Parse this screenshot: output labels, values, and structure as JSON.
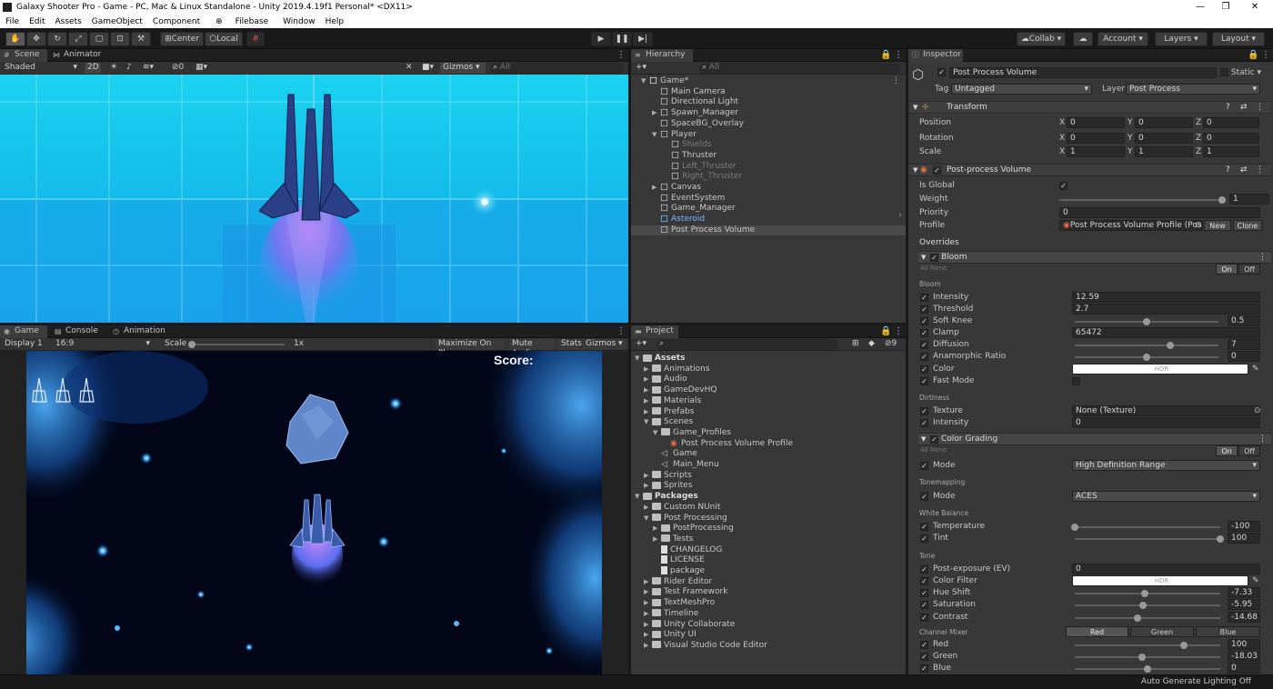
{
  "window": {
    "title": "Galaxy Shooter Pro - Game - PC, Mac & Linux Standalone - Unity 2019.4.19f1 Personal* <DX11>"
  },
  "menu": [
    "File",
    "Edit",
    "Assets",
    "GameObject",
    "Component",
    "Filebase",
    "Window",
    "Help"
  ],
  "toolbar": {
    "center": "Center",
    "local": "Local",
    "collab": "Collab",
    "account": "Account",
    "layers": "Layers",
    "layout": "Layout"
  },
  "scene": {
    "tabs": [
      "Scene",
      "Animator"
    ],
    "shading": "Shaded",
    "mode2d": "2D",
    "fx_count": "0",
    "gizmos": "Gizmos",
    "search_placeholder": "All"
  },
  "game": {
    "tabs": [
      "Game",
      "Console",
      "Animation"
    ],
    "display": "Display 1",
    "aspect": "16:9",
    "scale_label": "Scale",
    "scale_value": "1x",
    "maximize": "Maximize On Play",
    "mute": "Mute Audio",
    "stats": "Stats",
    "gizmos": "Gizmos",
    "score_label": "Score:"
  },
  "hierarchy": {
    "tab": "Hierarchy",
    "search_placeholder": "All",
    "items": [
      {
        "label": "Game*",
        "depth": 0,
        "expanded": true,
        "dim": false
      },
      {
        "label": "Main Camera",
        "depth": 1,
        "dim": false
      },
      {
        "label": "Directional Light",
        "depth": 1,
        "dim": false
      },
      {
        "label": "Spawn_Manager",
        "depth": 1,
        "collapsed": true,
        "dim": false
      },
      {
        "label": "SpaceBG_Overlay",
        "depth": 1,
        "dim": false
      },
      {
        "label": "Player",
        "depth": 1,
        "expanded": true,
        "dim": false
      },
      {
        "label": "Shields",
        "depth": 2,
        "dim": true
      },
      {
        "label": "Thruster",
        "depth": 2,
        "dim": false
      },
      {
        "label": "Left_Thruster",
        "depth": 2,
        "dim": true
      },
      {
        "label": "Right_Thruster",
        "depth": 2,
        "dim": true
      },
      {
        "label": "Canvas",
        "depth": 1,
        "collapsed": true,
        "dim": false
      },
      {
        "label": "EventSystem",
        "depth": 1,
        "dim": false
      },
      {
        "label": "Game_Manager",
        "depth": 1,
        "dim": false
      },
      {
        "label": "Asteroid",
        "depth": 1,
        "prefab": true,
        "dim": false
      },
      {
        "label": "Post Process Volume",
        "depth": 1,
        "selected": true,
        "dim": false
      }
    ]
  },
  "project": {
    "tab": "Project",
    "count": "9",
    "items": [
      {
        "label": "Assets",
        "depth": 0,
        "bold": true,
        "kind": "folder"
      },
      {
        "label": "Animations",
        "depth": 1,
        "kind": "folder"
      },
      {
        "label": "Audio",
        "depth": 1,
        "kind": "folder"
      },
      {
        "label": "GameDevHQ",
        "depth": 1,
        "kind": "folder"
      },
      {
        "label": "Materials",
        "depth": 1,
        "kind": "folder"
      },
      {
        "label": "Prefabs",
        "depth": 1,
        "kind": "folder"
      },
      {
        "label": "Scenes",
        "depth": 1,
        "kind": "folder"
      },
      {
        "label": "Game_Profiles",
        "depth": 2,
        "kind": "folder"
      },
      {
        "label": "Post Process Volume Profile",
        "depth": 3,
        "kind": "profile"
      },
      {
        "label": "Game",
        "depth": 2,
        "kind": "scene"
      },
      {
        "label": "Main_Menu",
        "depth": 2,
        "kind": "scene"
      },
      {
        "label": "Scripts",
        "depth": 1,
        "kind": "folder"
      },
      {
        "label": "Sprites",
        "depth": 1,
        "kind": "folder"
      },
      {
        "label": "Packages",
        "depth": 0,
        "bold": true,
        "kind": "folder"
      },
      {
        "label": "Custom NUnit",
        "depth": 1,
        "kind": "folder"
      },
      {
        "label": "Post Processing",
        "depth": 1,
        "kind": "folder"
      },
      {
        "label": "PostProcessing",
        "depth": 2,
        "kind": "folder"
      },
      {
        "label": "Tests",
        "depth": 2,
        "kind": "folder"
      },
      {
        "label": "CHANGELOG",
        "depth": 2,
        "kind": "doc"
      },
      {
        "label": "LICENSE",
        "depth": 2,
        "kind": "doc"
      },
      {
        "label": "package",
        "depth": 2,
        "kind": "doc"
      },
      {
        "label": "Rider Editor",
        "depth": 1,
        "kind": "folder"
      },
      {
        "label": "Test Framework",
        "depth": 1,
        "kind": "folder"
      },
      {
        "label": "TextMeshPro",
        "depth": 1,
        "kind": "folder"
      },
      {
        "label": "Timeline",
        "depth": 1,
        "kind": "folder"
      },
      {
        "label": "Unity Collaborate",
        "depth": 1,
        "kind": "folder"
      },
      {
        "label": "Unity UI",
        "depth": 1,
        "kind": "folder"
      },
      {
        "label": "Visual Studio Code Editor",
        "depth": 1,
        "kind": "folder"
      }
    ]
  },
  "inspector": {
    "tab": "Inspector",
    "object_name": "Post Process Volume",
    "static": "Static",
    "tag_label": "Tag",
    "tag_value": "Untagged",
    "layer_label": "Layer",
    "layer_value": "Post Process",
    "transform": {
      "title": "Transform",
      "position": "Position",
      "rotation": "Rotation",
      "scale": "Scale",
      "x": "X",
      "y": "Y",
      "z": "Z",
      "pos": [
        "0",
        "0",
        "0"
      ],
      "rot": [
        "0",
        "0",
        "0"
      ],
      "scl": [
        "1",
        "1",
        "1"
      ]
    },
    "ppv": {
      "title": "Post-process Volume",
      "is_global": "Is Global",
      "weight": "Weight",
      "weight_value": "1",
      "priority": "Priority",
      "priority_value": "0",
      "profile": "Profile",
      "profile_value": "Post Process Volume Profile (Pos",
      "new": "New",
      "clone": "Clone",
      "overrides": "Overrides"
    },
    "bloom": {
      "title": "Bloom",
      "all": "All",
      "none": "None",
      "on": "On",
      "off": "Off",
      "group": "Bloom",
      "dirtiness": "Dirtiness",
      "rows": [
        {
          "label": "Intensity",
          "value": "12.59",
          "type": "field"
        },
        {
          "label": "Threshold",
          "value": "2.7",
          "type": "field"
        },
        {
          "label": "Soft Knee",
          "value": "0.5",
          "type": "slider",
          "fill": 0.5
        },
        {
          "label": "Clamp",
          "value": "65472",
          "type": "field"
        },
        {
          "label": "Diffusion",
          "value": "7",
          "type": "slider",
          "fill": 0.667
        },
        {
          "label": "Anamorphic Ratio",
          "value": "0",
          "type": "slider",
          "fill": 0.5
        },
        {
          "label": "Color",
          "value": "HDR",
          "type": "color"
        },
        {
          "label": "Fast Mode",
          "value": "",
          "type": "check"
        }
      ],
      "dirt": [
        {
          "label": "Texture",
          "value": "None (Texture)"
        },
        {
          "label": "Intensity",
          "value": "0"
        }
      ]
    },
    "grading": {
      "title": "Color Grading",
      "all": "All",
      "none": "None",
      "on": "On",
      "off": "Off",
      "mode_label": "Mode",
      "mode_value": "High Definition Range",
      "tonemapping": "Tonemapping",
      "tm_mode_label": "Mode",
      "tm_mode_value": "ACES",
      "white_balance": "White Balance",
      "temperature": "Temperature",
      "temperature_value": "-100",
      "tint": "Tint",
      "tint_value": "100",
      "tone": "Tone",
      "post_exposure": "Post-exposure (EV)",
      "post_exposure_value": "0",
      "color_filter": "Color Filter",
      "color_filter_value": "HDR",
      "hue_shift": "Hue Shift",
      "hue_shift_value": "-7.33",
      "saturation": "Saturation",
      "saturation_value": "-5.95",
      "contrast": "Contrast",
      "contrast_value": "-14.68",
      "channel_mixer": "Channel Mixer",
      "channels": [
        "Red",
        "Green",
        "Blue"
      ],
      "red": "Red",
      "red_value": "100",
      "green": "Green",
      "green_value": "-18.03",
      "blue": "Blue",
      "blue_value": "0"
    }
  },
  "status": {
    "text": "Auto Generate Lighting Off"
  },
  "colors": {
    "scene_sky": "#16c9ea",
    "accent": "#3a72b0",
    "selected_row": "#2c5d87"
  }
}
